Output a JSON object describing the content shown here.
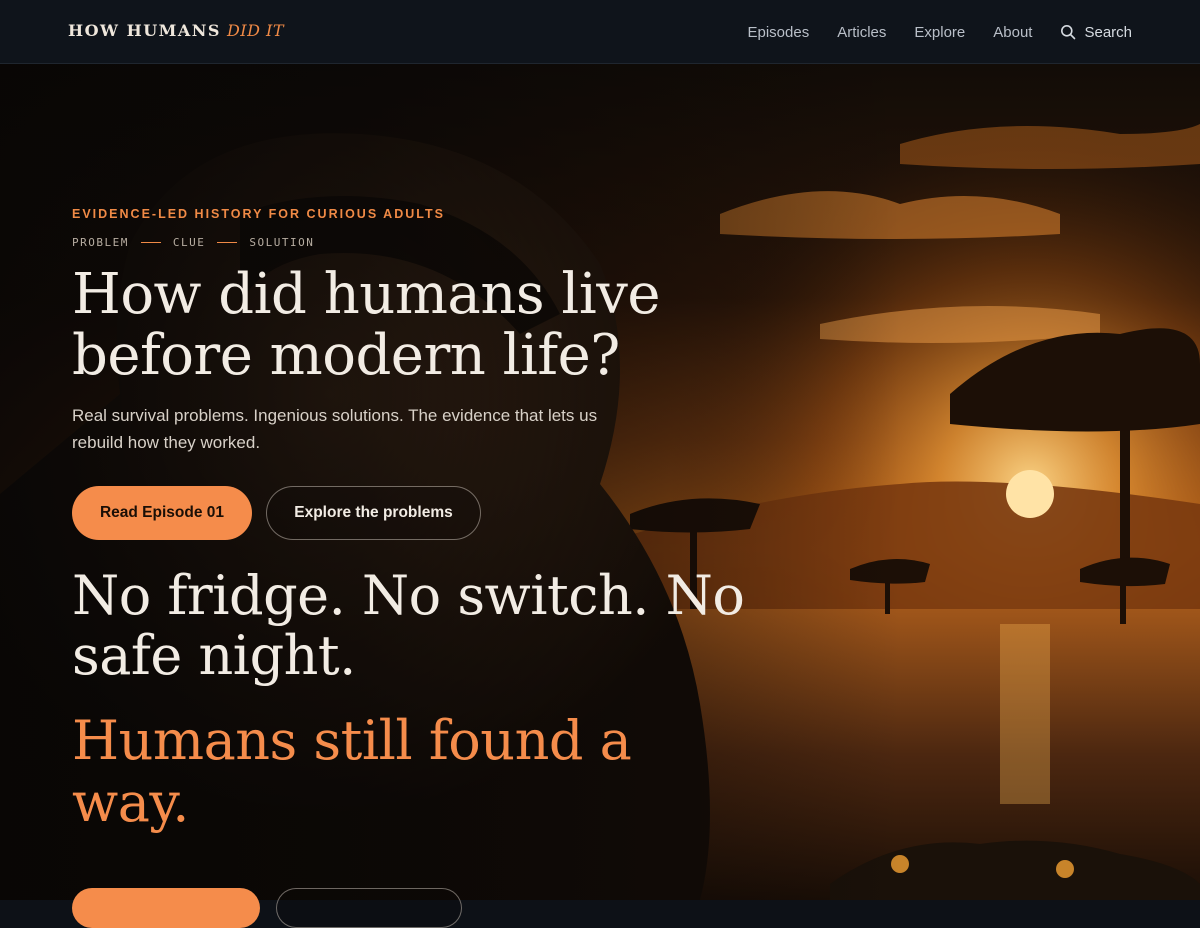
{
  "header": {
    "logo_main": "HOW HUMANS",
    "logo_accent": "DID IT",
    "nav": [
      {
        "label": "Episodes"
      },
      {
        "label": "Articles"
      },
      {
        "label": "Explore"
      },
      {
        "label": "About"
      }
    ],
    "search_label": "Search",
    "search_icon": "search-icon"
  },
  "hero": {
    "eyebrow": "EVIDENCE-LED HISTORY FOR CURIOUS ADULTS",
    "steps": [
      "PROBLEM",
      "CLUE",
      "SOLUTION"
    ],
    "headline": "How did humans live before modern life?",
    "lede": "Real survival problems. Ingenious solutions. The evidence that lets us rebuild how they worked.",
    "primary_button": "Read Episode 01",
    "secondary_button": "Explore the problems",
    "headline2": "No fridge. No switch. No safe night.",
    "headline3": "Humans still found a way."
  },
  "colors": {
    "accent": "#f58c4b",
    "header_bg": "#0f141b",
    "text_light": "#f2ece4"
  }
}
